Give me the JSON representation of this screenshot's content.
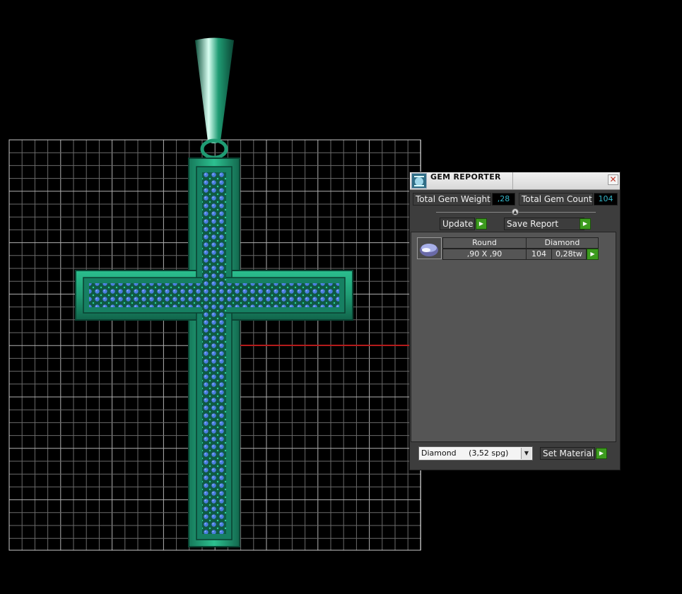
{
  "panel": {
    "title": "GEM REPORTER",
    "close_glyph": "✕",
    "total_gem_weight_label": "Total Gem Weight",
    "total_gem_weight_value": ",28",
    "total_gem_count_label": "Total Gem Count",
    "total_gem_count_value": "104",
    "update_label": "Update",
    "save_report_label": "Save Report",
    "gem_rows": [
      {
        "shape": "Round",
        "type": "Diamond",
        "size": ",90 X ,90",
        "count": "104",
        "weight": "0,28tw"
      }
    ],
    "material_selected": "Diamond     (3,52 spg)",
    "set_material_label": "Set Material"
  },
  "icons": {
    "title_icon": "gem-reporter-icon",
    "close": "close-icon",
    "arrow": "play-arrow-icon",
    "gem": "round-gem-icon",
    "dropdown": "chevron-down-icon"
  },
  "colors": {
    "metal": "#1f9b73",
    "gem": "#4a7de0",
    "grid": "#8a8a8a",
    "axis_red": "#b41b1b",
    "value_text": "#35b6c9",
    "arrow_green": "#3c9b1e"
  }
}
